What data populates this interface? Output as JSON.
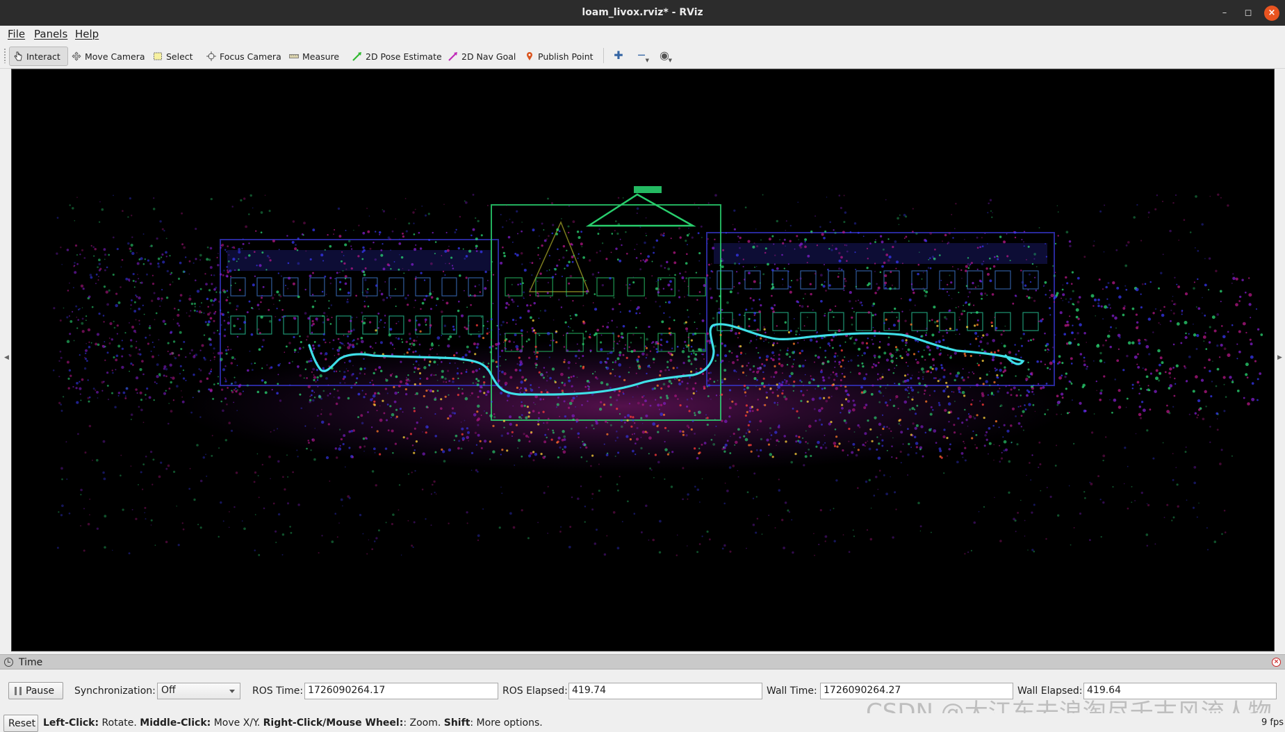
{
  "window": {
    "title": "loam_livox.rviz* - RViz"
  },
  "menu": {
    "file": "File",
    "panels": "Panels",
    "help": "Help"
  },
  "toolbar": {
    "interact": "Interact",
    "move_camera": "Move Camera",
    "select": "Select",
    "focus_camera": "Focus Camera",
    "measure": "Measure",
    "pose_estimate": "2D Pose Estimate",
    "nav_goal": "2D Nav Goal",
    "publish_point": "Publish Point",
    "add_tool_icon": "plus-icon",
    "remove_tool_icon": "minus-icon",
    "view_icon": "eye-icon"
  },
  "time_panel": {
    "title": "Time",
    "pause_label": "Pause",
    "sync_label": "Synchronization:",
    "sync_value": "Off",
    "ros_time_label": "ROS Time:",
    "ros_time_value": "1726090264.17",
    "ros_elapsed_label": "ROS Elapsed:",
    "ros_elapsed_value": "419.74",
    "wall_time_label": "Wall Time:",
    "wall_time_value": "1726090264.27",
    "wall_elapsed_label": "Wall Elapsed:",
    "wall_elapsed_value": "419.64"
  },
  "status": {
    "reset_label": "Reset",
    "left_click": "Left-Click:",
    "left_click_desc": " Rotate. ",
    "middle_click": "Middle-Click:",
    "middle_click_desc": " Move X/Y. ",
    "right_click": "Right-Click/Mouse Wheel:",
    "right_click_desc": ": Zoom. ",
    "shift": "Shift",
    "shift_desc": ": More options.",
    "fps": "9 fps"
  },
  "watermark": "CSDN @大江东去浪淘尽千古风流人物",
  "colors": {
    "titlebar": "#2c2c2c",
    "close_button": "#e95420",
    "viewport_bg": "#000000",
    "trajectory": "#3fe0e8",
    "point_green": "#2ee67a",
    "point_blue": "#3b3bff",
    "point_purple": "#8a1fd8",
    "point_magenta": "#c0188f"
  }
}
